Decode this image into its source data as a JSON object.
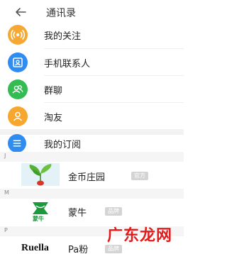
{
  "header": {
    "title": "通讯录",
    "back_icon": "arrow-left-icon"
  },
  "menu": [
    {
      "label": "我的关注",
      "icon": "radio-waves-icon",
      "color": "#F6A833"
    },
    {
      "label": "手机联系人",
      "icon": "contact-card-icon",
      "color": "#2F8CF1"
    },
    {
      "label": "群聊",
      "icon": "group-icon",
      "color": "#33BC52"
    },
    {
      "label": "淘友",
      "icon": "user-icon",
      "color": "#F7A62E"
    }
  ],
  "subscriptions": {
    "label": "我的订阅",
    "icon": "list-icon",
    "color": "#2F8CF1"
  },
  "sections": [
    {
      "letter": "J",
      "name": "金币庄园",
      "badge": "官方",
      "logo": "plant-icon"
    },
    {
      "letter": "M",
      "name": "蒙牛",
      "badge": "品牌",
      "logo": "mengniu-logo",
      "logo_text": "蒙牛"
    },
    {
      "letter": "P",
      "name": "Pa粉",
      "badge": "品牌",
      "logo": "ruella-logo",
      "logo_text": "Ruella"
    }
  ],
  "watermark": "广东龙网"
}
